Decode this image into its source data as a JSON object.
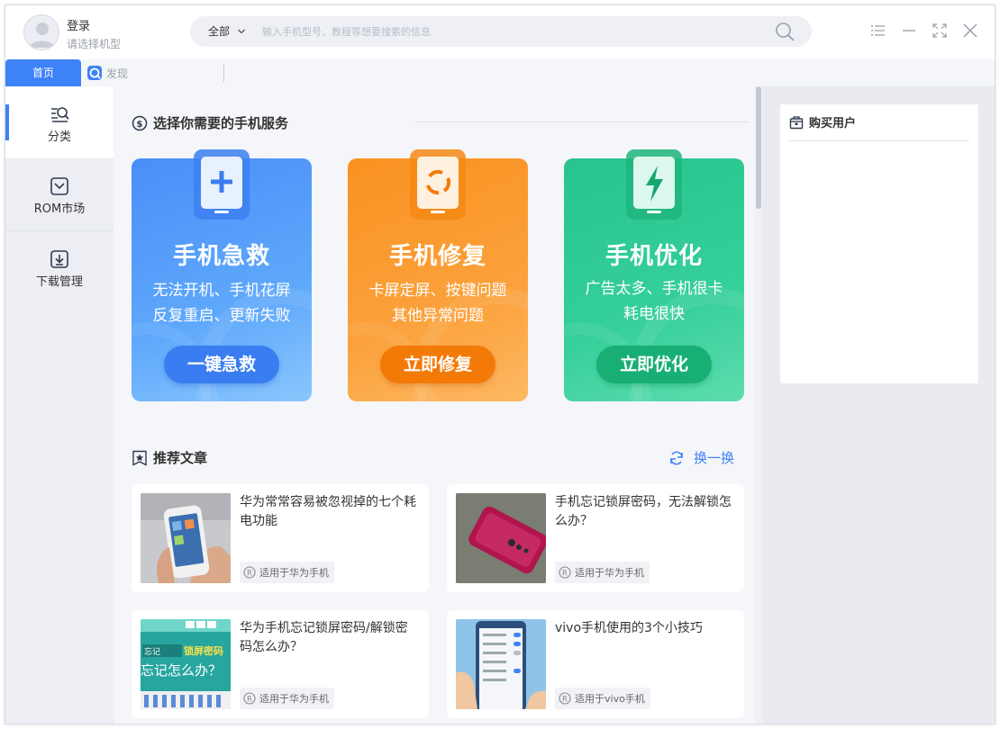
{
  "header": {
    "login_title": "登录",
    "login_subtitle": "请选择机型",
    "search_scope": "全部",
    "search_placeholder": "输入手机型号、教程等想要搜索的信息"
  },
  "tabs": [
    {
      "label": "首页",
      "active": true
    },
    {
      "label": "发现",
      "active": false
    }
  ],
  "sidebar": {
    "items": [
      {
        "label": "分类",
        "icon": "category-search-icon",
        "active": true
      },
      {
        "label": "ROM市场",
        "icon": "rom-market-icon",
        "active": false
      },
      {
        "label": "下载管理",
        "icon": "download-icon",
        "active": false
      }
    ]
  },
  "services": {
    "heading": "选择你需要的手机服务",
    "cards": [
      {
        "title": "手机急救",
        "desc_line1": "无法开机、手机花屏",
        "desc_line2": "反复重启、更新失败",
        "button": "一键急救",
        "color": "#4a8ef8",
        "icon": "plus-icon"
      },
      {
        "title": "手机修复",
        "desc_line1": "卡屏定屏、按键问题",
        "desc_line2": "其他异常问题",
        "button": "立即修复",
        "color": "#f99222",
        "icon": "repair-spinner-icon"
      },
      {
        "title": "手机优化",
        "desc_line1": "广告太多、手机很卡",
        "desc_line2": "耗电很快",
        "button": "立即优化",
        "color": "#29c48e",
        "icon": "lightning-icon"
      }
    ]
  },
  "articles": {
    "heading": "推荐文章",
    "refresh_label": "换一换",
    "items": [
      {
        "title": "华为常常容易被忽视掉的七个耗电功能",
        "tag": "适用于华为手机"
      },
      {
        "title": "手机忘记锁屏密码，无法解锁怎么办？",
        "tag": "适用于华为手机"
      },
      {
        "title": "华为手机忘记锁屏密码/解锁密码怎么办？",
        "tag": "适用于华为手机",
        "thumb_line1_a": "忘记",
        "thumb_line1_b": "锁屏密码",
        "thumb_line2": "忘记怎么办？"
      },
      {
        "title": "vivo手机使用的3个小技巧",
        "tag": "适用于vivo手机"
      }
    ]
  },
  "right_panel": {
    "heading": "购买用户"
  },
  "colors": {
    "accent": "#3e82f7",
    "sidebar_bg": "#eceef4",
    "main_bg": "#f5f6f9"
  }
}
